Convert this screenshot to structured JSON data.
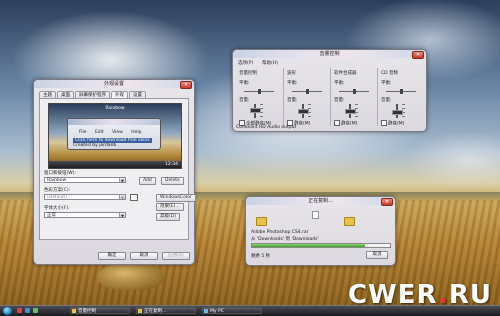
{
  "appearance": {
    "title": "外观设置",
    "tabs": [
      "主题",
      "桌面",
      "屏幕保护程序",
      "外观",
      "设置"
    ],
    "active_tab": 3,
    "preview": {
      "label": "Rainbow",
      "menu": [
        "File",
        "Edit",
        "View",
        "Help"
      ],
      "highlight_text": "Click here to download free skins",
      "text_line2": "Created by jordanb",
      "clock": "12:34"
    },
    "style_label": "窗口和按钮(W):",
    "style_value": "Rainbow",
    "add_btn": "Add",
    "delete_btn": "Delete",
    "color_scheme_label": "色彩方案(C):",
    "color_scheme_value": "(Default)",
    "font_size_label": "字体大小(F):",
    "font_size_value": "正常",
    "window_color_btn": "WindowsColor",
    "effects_btn": "效果(E)...",
    "advanced_btn": "高级(D)",
    "ok_btn": "确定",
    "cancel_btn": "取消",
    "apply_btn": "应用(A)"
  },
  "mixer": {
    "title": "音量控制",
    "menu": [
      "选项(P)",
      "帮助(H)"
    ],
    "columns": [
      {
        "title": "音量控制",
        "balance_label": "平衡:",
        "volume_label": "音量:",
        "mute_label": "全部静音(M)",
        "volume_level": 0.7
      },
      {
        "title": "波形",
        "balance_label": "平衡:",
        "volume_label": "音量:",
        "mute_label": "静音(M)",
        "volume_level": 0.55
      },
      {
        "title": "软件合成器",
        "balance_label": "平衡:",
        "volume_label": "音量:",
        "mute_label": "静音(M)",
        "volume_level": 0.6
      },
      {
        "title": "CD 音频",
        "balance_label": "平衡:",
        "volume_label": "音量:",
        "mute_label": "静音(M)",
        "volume_level": 0.5
      }
    ],
    "status": "Conexant HD Audio output"
  },
  "copy": {
    "title": "正在复制...",
    "file_name": "Adobe Photoshop CS4.rar",
    "from_to": "从 'Downloads' 到 'Downloads'",
    "remaining": "剩余 5 秒",
    "cancel_btn": "取消",
    "progress": 0.82
  },
  "taskbar": {
    "tasks": [
      "音量控制",
      "正在复制...",
      "My PC"
    ]
  },
  "watermark": {
    "text_main": "CWER",
    "text_dot": ".",
    "text_end": "RU"
  }
}
